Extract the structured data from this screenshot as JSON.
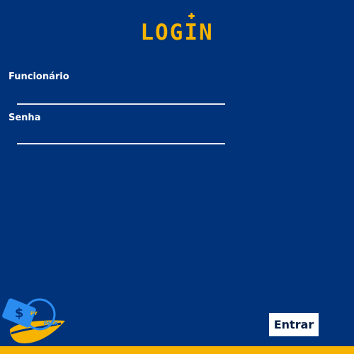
{
  "header": {
    "title": "LOGIN"
  },
  "form": {
    "employee_label": "Funcionário",
    "employee_value": "",
    "password_label": "Senha",
    "password_value": ""
  },
  "actions": {
    "submit_label": "Entrar"
  },
  "logo": {
    "currency_symbol": "$",
    "text_top": "PY",
    "text_bottom": "PACK",
    "icon": "payment-card-leaf-logo"
  },
  "colors": {
    "background": "#00337a",
    "accent": "#f6b400",
    "logo_blue": "#2b8cf0",
    "text": "#ffffff"
  }
}
